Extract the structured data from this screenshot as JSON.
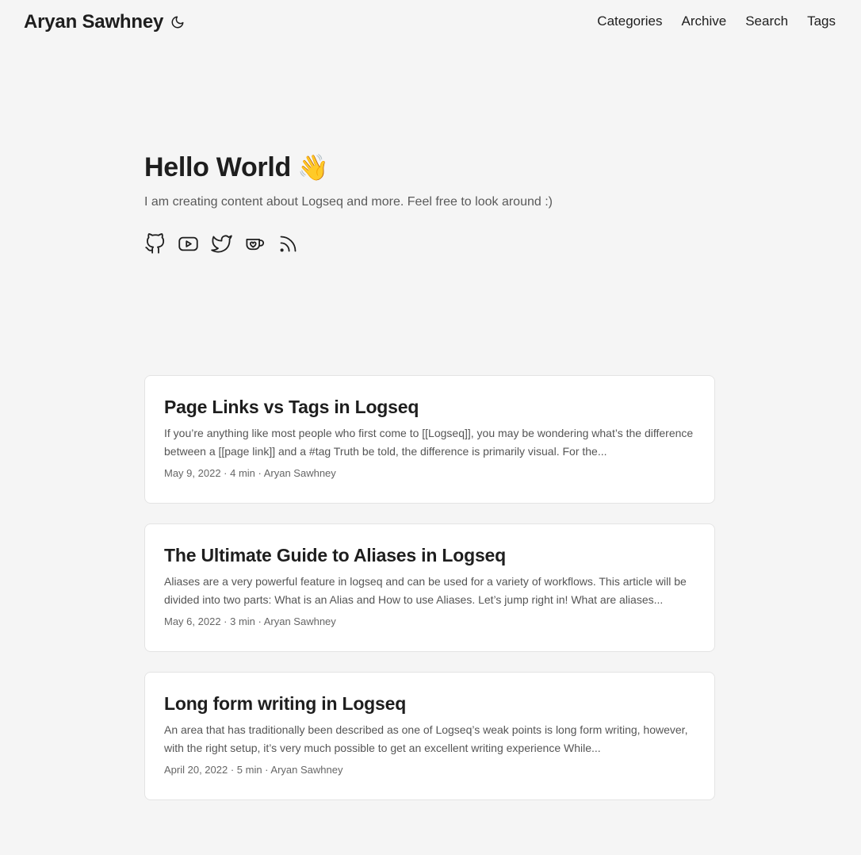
{
  "header": {
    "brand": "Aryan Sawhney",
    "theme_icon": "moon-icon",
    "nav": [
      {
        "label": "Categories"
      },
      {
        "label": "Archive"
      },
      {
        "label": "Search"
      },
      {
        "label": "Tags"
      }
    ]
  },
  "hero": {
    "title": "Hello World",
    "emoji": "👋",
    "subtitle": "I am creating content about Logseq and more. Feel free to look around :)",
    "socials": [
      "github-icon",
      "youtube-icon",
      "twitter-icon",
      "kofi-icon",
      "rss-icon"
    ]
  },
  "posts": [
    {
      "title": "Page Links vs Tags in Logseq",
      "excerpt": "If you’re anything like most people who first come to [[Logseq]], you may be wondering what’s the difference between a [[page link]] and a #tag Truth be told, the difference is primarily visual. For the...",
      "meta": "May 9, 2022 · 4 min · Aryan Sawhney"
    },
    {
      "title": "The Ultimate Guide to Aliases in Logseq",
      "excerpt": "Aliases are a very powerful feature in logseq and can be used for a variety of workflows. This article will be divided into two parts: What is an Alias and How to use Aliases. Let’s jump right in! What are aliases...",
      "meta": "May 6, 2022 · 3 min · Aryan Sawhney"
    },
    {
      "title": "Long form writing in Logseq",
      "excerpt": "An area that has traditionally been described as one of Logseq’s weak points is long form writing, however, with the right setup, it’s very much possible to get an excellent writing experience While...",
      "meta": "April 20, 2022 · 5 min · Aryan Sawhney"
    }
  ]
}
